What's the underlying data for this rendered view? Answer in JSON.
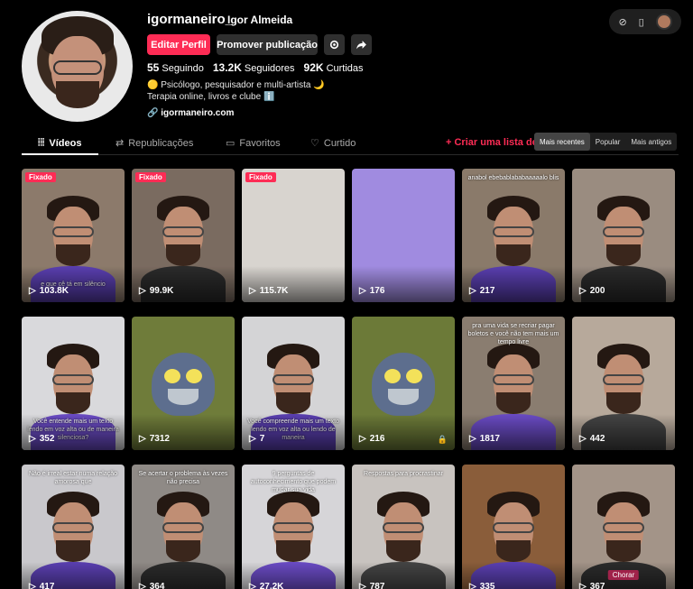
{
  "profile": {
    "handle": "igormaneiro_",
    "display_name": "Igor Almeida",
    "edit_label": "Editar Perfil",
    "promote_label": "Promover publicação",
    "following_count": "55",
    "following_label": "Seguindo",
    "followers_count": "13.2K",
    "followers_label": "Seguidores",
    "likes_count": "92K",
    "likes_label": "Curtidas",
    "bio_line1": "🟡 Psicólogo, pesquisador e multi-artista 🌙",
    "bio_line2": "Terapia online, livros e clube ℹ️",
    "link": "igormaneiro.com"
  },
  "tabs": [
    {
      "label": "Vídeos"
    },
    {
      "label": "Republicações"
    },
    {
      "label": "Favoritos"
    },
    {
      "label": "Curtido"
    }
  ],
  "playlist_link": "Criar uma lista de re",
  "sort_options": [
    "Mais recentes",
    "Popular",
    "Mais antigos"
  ],
  "videos": [
    {
      "views": "103.8K",
      "pinned": "Fixado",
      "caption": "e que cê tá em silêncio",
      "bg": "#8c7a6b"
    },
    {
      "views": "99.9K",
      "pinned": "Fixado",
      "caption": "",
      "bg": "#7a6b60"
    },
    {
      "views": "115.7K",
      "pinned": "Fixado",
      "caption": "",
      "bg": "#d8d4cf"
    },
    {
      "views": "176",
      "pinned": "",
      "caption": "",
      "bg": "#a08be0"
    },
    {
      "views": "217",
      "pinned": "",
      "caption": "anabol ebebablababaaaaalo blis",
      "bg": "#8a7a6a"
    },
    {
      "views": "200",
      "pinned": "",
      "caption": "",
      "bg": "#9a8c80"
    },
    {
      "views": "352",
      "pinned": "",
      "caption": "Você entende mais um texto lendo em voz alta ou de maneira silenciosa?",
      "bg": "#d9d9dc"
    },
    {
      "views": "7312",
      "pinned": "",
      "caption": "",
      "bg": "#6f7c3a"
    },
    {
      "views": "7",
      "pinned": "",
      "caption": "Você compreende mais um texto lendo em voz alta ou lendo de maneira",
      "bg": "#d4d4d6"
    },
    {
      "views": "216",
      "pinned": "",
      "caption": "",
      "bg": "#6c7a38"
    },
    {
      "views": "1817",
      "pinned": "",
      "caption": "pra uma vida se recriar pagar boletos e você não tem mais um tempo livre",
      "bg": "#8a7d70"
    },
    {
      "views": "442",
      "pinned": "",
      "caption": "",
      "bg": "#b7a99b"
    },
    {
      "views": "417",
      "pinned": "",
      "caption": "Não é irreal estar numa relação amorosa que",
      "bg": "#c9c8cc"
    },
    {
      "views": "364",
      "pinned": "",
      "caption": "Se acertar o problema às vezes não precisa",
      "bg": "#8f8a86"
    },
    {
      "views": "27.2K",
      "pinned": "",
      "caption": "9 perguntas de autoconhecimento que podem mudar sua vida",
      "bg": "#d6d5d8"
    },
    {
      "views": "787",
      "pinned": "",
      "caption": "Respostas para procrastinar",
      "bg": "#c8c3bf"
    },
    {
      "views": "335",
      "pinned": "",
      "caption": "",
      "bg": "#8a5d3a"
    },
    {
      "views": "367",
      "pinned": "",
      "caption": "",
      "bg": "#a39488",
      "tag": "Chorar"
    }
  ]
}
